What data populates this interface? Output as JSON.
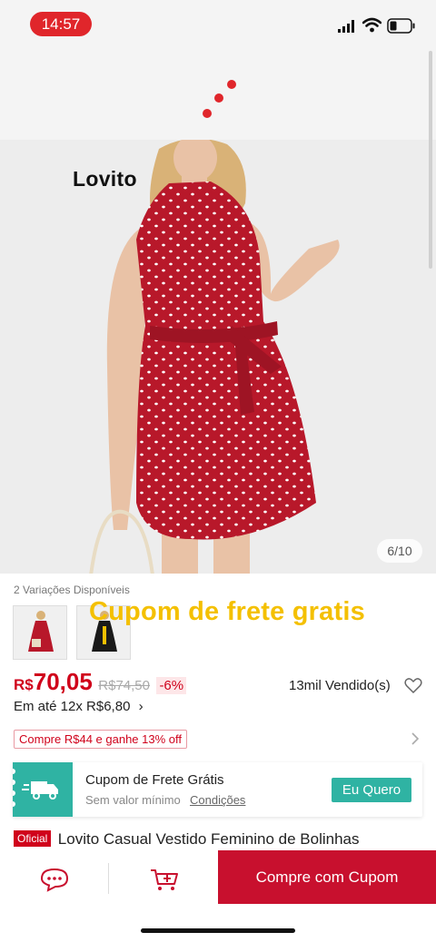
{
  "status": {
    "time": "14:57"
  },
  "gallery": {
    "brand": "Lovito",
    "counter": "6/10"
  },
  "variations": {
    "label": "2 Variações Disponíveis",
    "overlay_text": "Cupom de frete gratis",
    "swatches": [
      "red-dress",
      "black-dress"
    ]
  },
  "price": {
    "currency": "R$",
    "current": "70,05",
    "original": "R$74,50",
    "discount": "-6%",
    "sold": "13mil Vendido(s)",
    "installments": "Em até 12x R$6,80"
  },
  "promo": {
    "tag": "Compre R$44 e ganhe 13% off"
  },
  "coupon": {
    "title": "Cupom de Frete Grátis",
    "subtitle": "Sem valor mínimo",
    "link": "Condições",
    "button": "Eu Quero"
  },
  "product": {
    "badge": "Oficial",
    "title": "Lovito Casual Vestido Feminino de Bolinhas"
  },
  "bottom": {
    "buy_button": "Compre com Cupom"
  },
  "colors": {
    "accent": "#d0021b",
    "buy": "#c8102e",
    "teal": "#2fb3a3",
    "overlay": "#f4c000"
  },
  "icons": [
    "signal-icon",
    "wifi-icon",
    "battery-icon",
    "heart-icon",
    "chevron-right-icon",
    "truck-icon",
    "chat-icon",
    "cart-add-icon"
  ]
}
